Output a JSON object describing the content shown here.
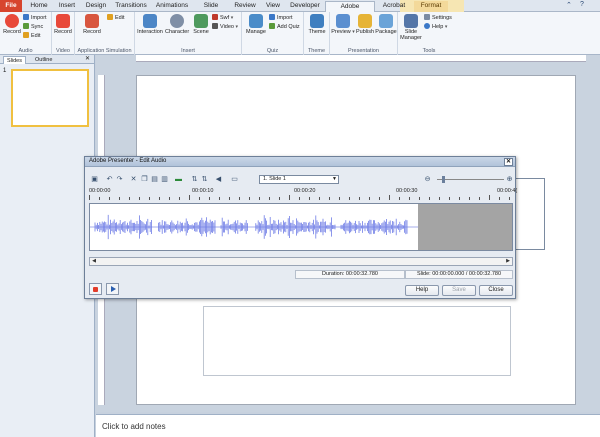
{
  "tabs": [
    "File",
    "Home",
    "Insert",
    "Design",
    "Transitions",
    "Animations",
    "Slide Show",
    "Review",
    "View",
    "Developer",
    "Adobe Presenter",
    "Acrobat",
    "Format"
  ],
  "ribbon": {
    "audio": {
      "label": "Audio",
      "record": "Record",
      "import": "Import",
      "sync": "Sync",
      "edit": "Edit"
    },
    "video": {
      "label": "Video",
      "record": "Record"
    },
    "appsim": {
      "label": "Application Simulation",
      "record": "Record",
      "edit": "Edit"
    },
    "insert": {
      "label": "Insert",
      "interaction": "Interaction",
      "character": "Character",
      "scene": "Scene",
      "swf": "Swf",
      "video": "Video"
    },
    "quiz": {
      "label": "Quiz",
      "manage": "Manage",
      "import": "Import",
      "add_quiz": "Add Quiz"
    },
    "theme": {
      "label": "Theme",
      "theme": "Theme"
    },
    "presentation": {
      "label": "Presentation",
      "preview": "Preview",
      "publish": "Publish",
      "package": "Package"
    },
    "tools": {
      "label": "Tools",
      "slide_manager": "Slide Manager",
      "settings": "Settings",
      "help": "Help"
    }
  },
  "left_panel": {
    "tab_slides": "Slides",
    "tab_outline": "Outline",
    "slide_number": "1"
  },
  "notes": {
    "placeholder": "Click to add notes"
  },
  "dialog": {
    "title": "Adobe Presenter - Edit Audio",
    "slide_select": "1. Slide 1",
    "time_labels": [
      "00:00:00",
      "00:00:10",
      "00:00:20",
      "00:00:30",
      "00:00:4("
    ],
    "duration": "Duration: 00:00:32.780",
    "slide_time": "Slide: 00:00:00.000 / 00:00:32.780",
    "buttons": {
      "help": "Help",
      "save": "Save",
      "close": "Close"
    }
  }
}
